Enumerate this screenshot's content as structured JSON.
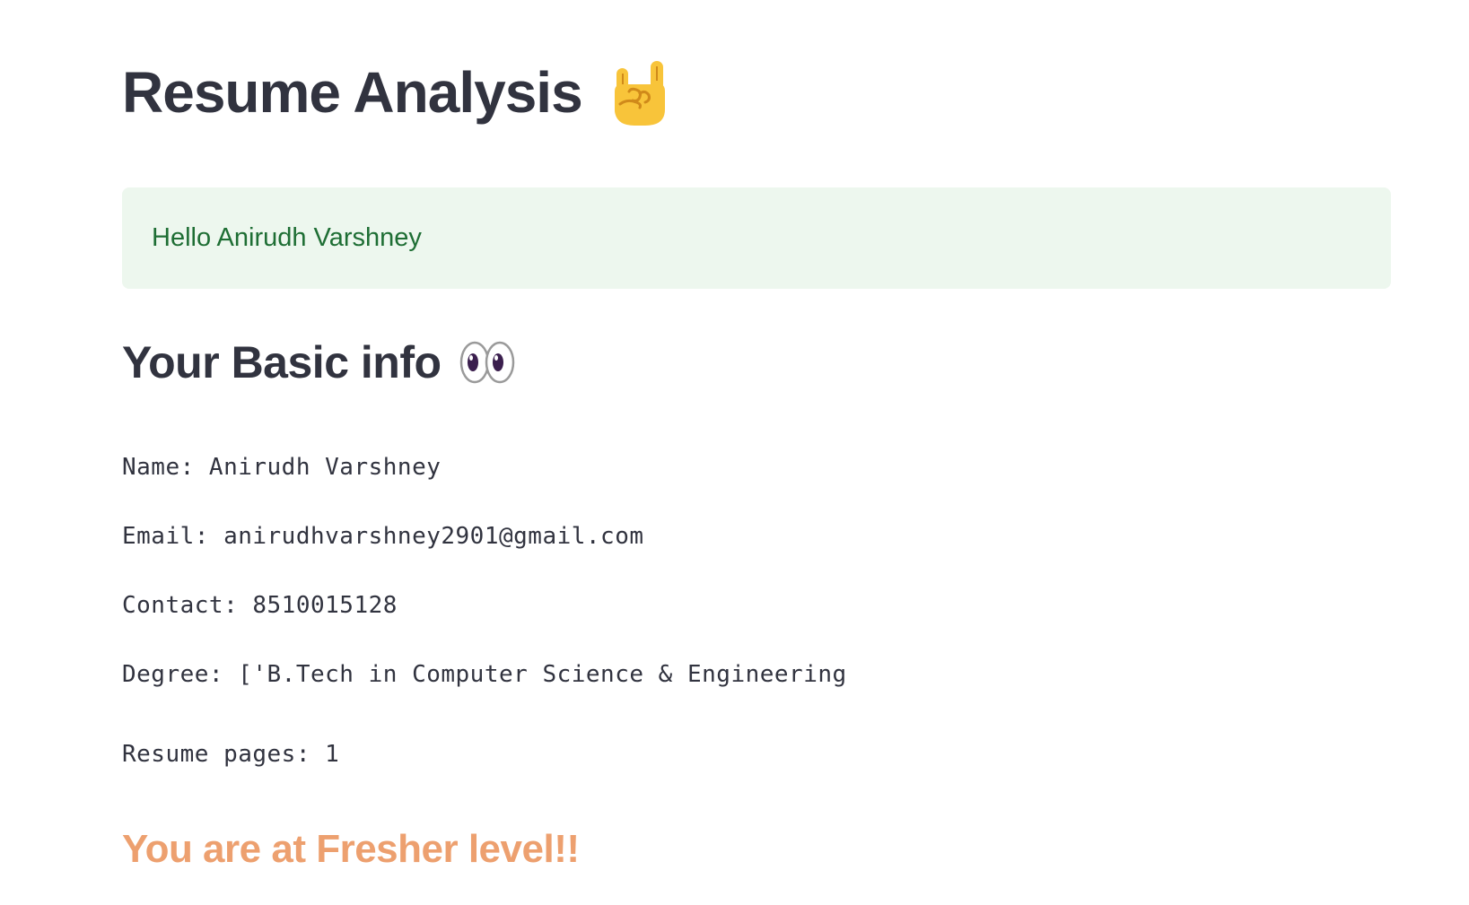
{
  "header": {
    "title": "Resume Analysis",
    "title_icon": "rock-on-hand-icon"
  },
  "greeting": {
    "text": "Hello Anirudh Varshney",
    "bg_color": "#edf7ee",
    "text_color": "#1e6e34"
  },
  "basic_info": {
    "heading": "Your Basic info",
    "heading_icon": "eyes-icon",
    "name_line": "Name: Anirudh Varshney",
    "email_line": "Email: anirudhvarshney2901@gmail.com",
    "contact_line": "Contact: 8510015128",
    "degree_line": "Degree: ['B.Tech in Computer Science & Engineering",
    "pages_line": "Resume pages: 1"
  },
  "level": {
    "text": "You are at Fresher level!!",
    "color": "#eda06f"
  }
}
